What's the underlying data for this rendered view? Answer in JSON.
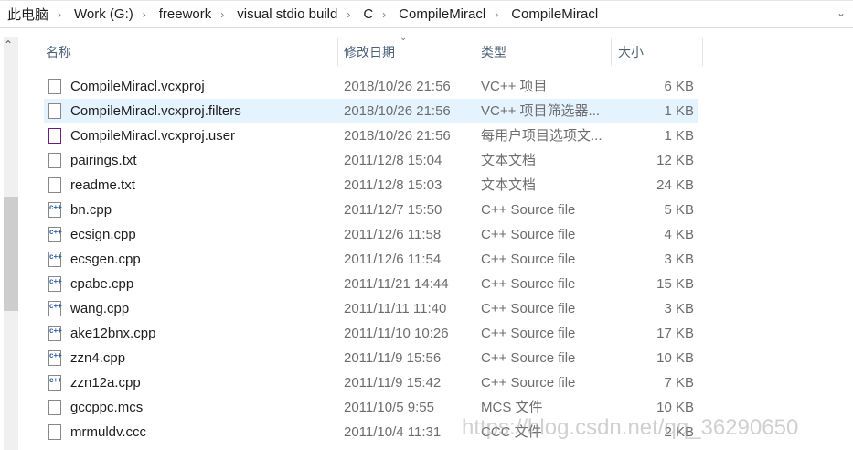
{
  "breadcrumb": [
    "此电脑",
    "Work (G:)",
    "freework",
    "visual stdio build",
    "C",
    "CompileMiracl",
    "CompileMiracl"
  ],
  "columns": {
    "name": "名称",
    "date": "修改日期",
    "type": "类型",
    "size": "大小"
  },
  "files": [
    {
      "name": "CompileMiracl.vcxproj",
      "date": "2018/10/26 21:56",
      "type": "VC++ 项目",
      "size": "6 KB",
      "icon": "vcxproj-icon"
    },
    {
      "name": "CompileMiracl.vcxproj.filters",
      "date": "2018/10/26 21:56",
      "type": "VC++ 项目筛选器...",
      "size": "1 KB",
      "icon": "filters-icon",
      "selected": true
    },
    {
      "name": "CompileMiracl.vcxproj.user",
      "date": "2018/10/26 21:56",
      "type": "每用户项目选项文...",
      "size": "1 KB",
      "icon": "vs-user-icon"
    },
    {
      "name": "pairings.txt",
      "date": "2011/12/8 15:04",
      "type": "文本文档",
      "size": "12 KB",
      "icon": "text-file-icon"
    },
    {
      "name": "readme.txt",
      "date": "2011/12/8 15:03",
      "type": "文本文档",
      "size": "24 KB",
      "icon": "text-file-icon"
    },
    {
      "name": "bn.cpp",
      "date": "2011/12/7 15:50",
      "type": "C++ Source file",
      "size": "5 KB",
      "icon": "cpp-file-icon"
    },
    {
      "name": "ecsign.cpp",
      "date": "2011/12/6 11:58",
      "type": "C++ Source file",
      "size": "4 KB",
      "icon": "cpp-file-icon"
    },
    {
      "name": "ecsgen.cpp",
      "date": "2011/12/6 11:54",
      "type": "C++ Source file",
      "size": "3 KB",
      "icon": "cpp-file-icon"
    },
    {
      "name": "cpabe.cpp",
      "date": "2011/11/21 14:44",
      "type": "C++ Source file",
      "size": "15 KB",
      "icon": "cpp-file-icon"
    },
    {
      "name": "wang.cpp",
      "date": "2011/11/11 11:40",
      "type": "C++ Source file",
      "size": "3 KB",
      "icon": "cpp-file-icon"
    },
    {
      "name": "ake12bnx.cpp",
      "date": "2011/11/10 10:26",
      "type": "C++ Source file",
      "size": "17 KB",
      "icon": "cpp-file-icon"
    },
    {
      "name": "zzn4.cpp",
      "date": "2011/11/9 15:56",
      "type": "C++ Source file",
      "size": "10 KB",
      "icon": "cpp-file-icon"
    },
    {
      "name": "zzn12a.cpp",
      "date": "2011/11/9 15:42",
      "type": "C++ Source file",
      "size": "7 KB",
      "icon": "cpp-file-icon"
    },
    {
      "name": "gccppc.mcs",
      "date": "2011/10/5 9:55",
      "type": "MCS 文件",
      "size": "10 KB",
      "icon": "blank-file-icon"
    },
    {
      "name": "mrmuldv.ccc",
      "date": "2011/10/4 11:31",
      "type": "CCC 文件",
      "size": "2 KB",
      "icon": "blank-file-icon"
    }
  ],
  "watermark": "https://blog.csdn.net/qq_36290650"
}
